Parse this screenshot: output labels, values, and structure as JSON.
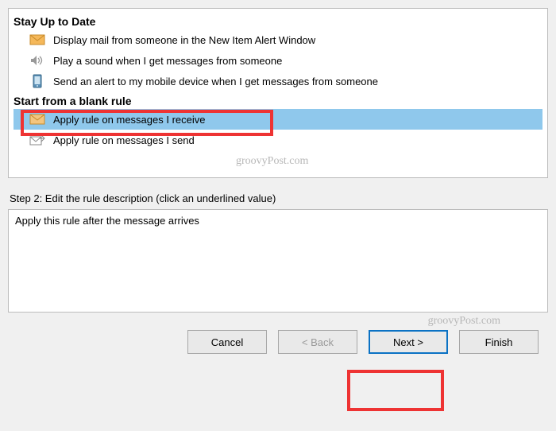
{
  "sections": {
    "stay_up": {
      "header": "Stay Up to Date",
      "items": [
        {
          "label": "Display mail from someone in the New Item Alert Window"
        },
        {
          "label": "Play a sound when I get messages from someone"
        },
        {
          "label": "Send an alert to my mobile device when I get messages from someone"
        }
      ]
    },
    "blank_rule": {
      "header": "Start from a blank rule",
      "items": [
        {
          "label": "Apply rule on messages I receive",
          "selected": true
        },
        {
          "label": "Apply rule on messages I send"
        }
      ]
    }
  },
  "step2": {
    "label": "Step 2: Edit the rule description (click an underlined value)",
    "description": "Apply this rule after the message arrives"
  },
  "buttons": {
    "cancel": "Cancel",
    "back": "< Back",
    "next": "Next >",
    "finish": "Finish"
  },
  "watermark": "groovyPost.com"
}
